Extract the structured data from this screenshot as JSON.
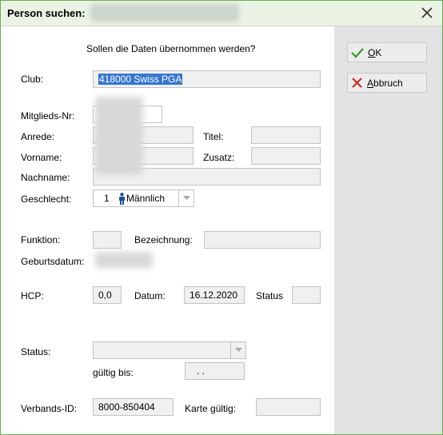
{
  "window": {
    "title": "Person suchen:"
  },
  "prompt": "Sollen die Daten übernommen werden?",
  "buttons": {
    "ok_label_u": "O",
    "ok_label_rest": "K",
    "cancel_label_u": "A",
    "cancel_label_rest": "bbruch"
  },
  "form": {
    "club_label": "Club:",
    "club_value": "418000 Swiss PGA",
    "mitglieds_label": "Mitglieds-Nr:",
    "anrede_label": "Anrede:",
    "titel_label": "Titel:",
    "vorname_label": "Vorname:",
    "zusatz_label": "Zusatz:",
    "nachname_label": "Nachname:",
    "geschlecht_label": "Geschlecht:",
    "geschlecht_code": "1",
    "geschlecht_value": "Männlich",
    "funktion_label": "Funktion:",
    "bezeichnung_label": "Bezeichnung:",
    "geburtsdatum_label": "Geburtsdatum:",
    "hcp_label": "HCP:",
    "hcp_value": "0,0",
    "datum_label": "Datum:",
    "datum_value": "16.12.2020",
    "status_label_inline": "Status",
    "status_label": "Status:",
    "gueltig_label": "gültig bis:",
    "gueltig_value": ". .",
    "verbands_label": "Verbands-ID:",
    "verbands_value": "8000-850404",
    "karte_label": "Karte gültig:"
  },
  "colors": {
    "window_border": "#6cad4f",
    "ok_check": "#3a9a2a",
    "cancel_x": "#d42a2a",
    "selection": "#3477d4",
    "person_icon": "#1f4f8f"
  }
}
